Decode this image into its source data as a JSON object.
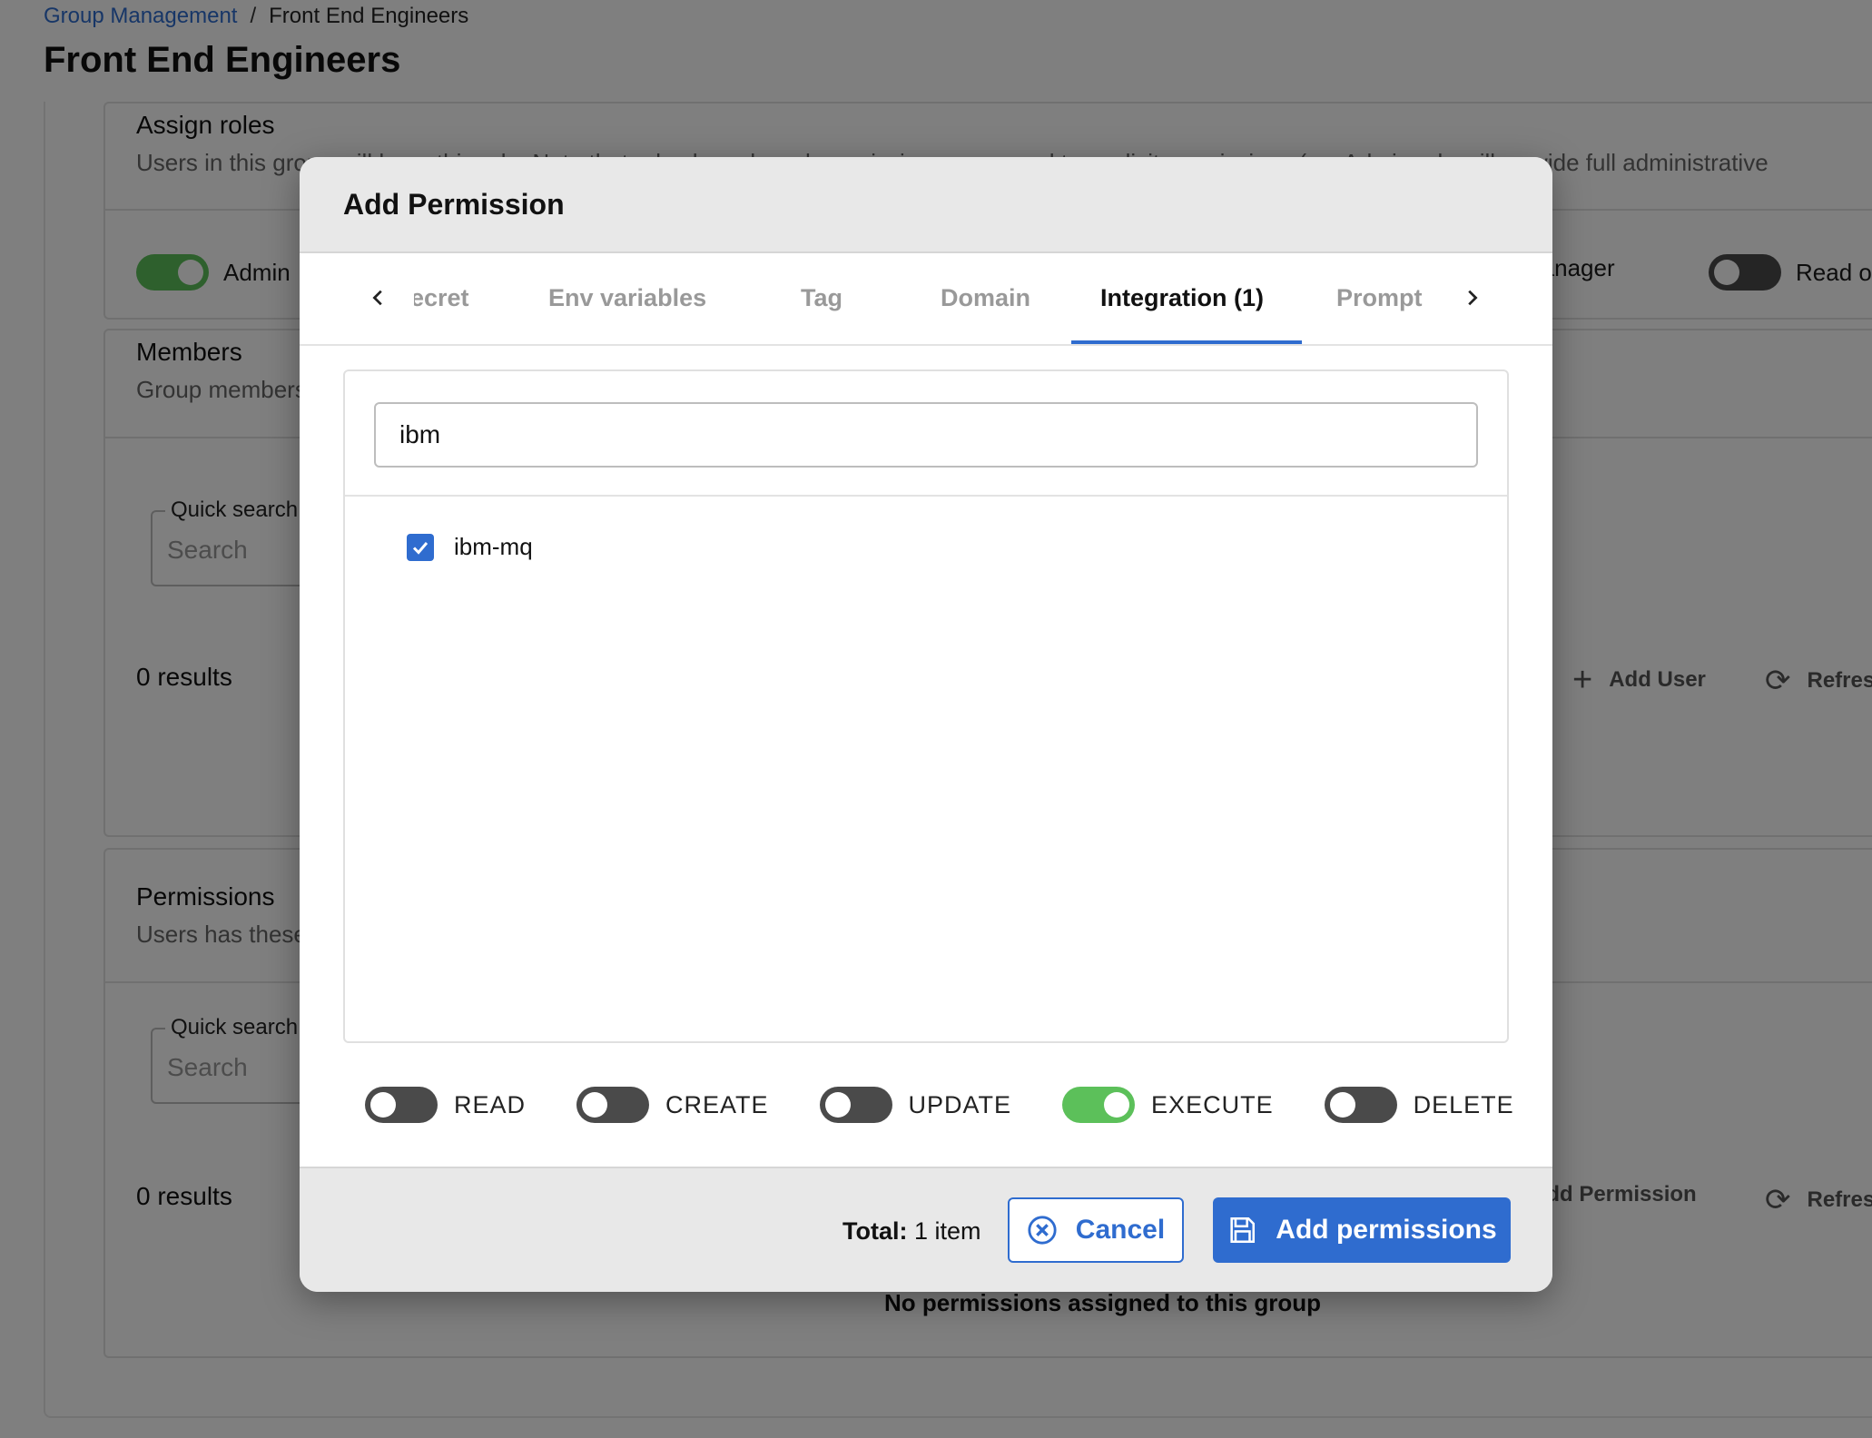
{
  "breadcrumb": {
    "parent": "Group Management",
    "separator": "/",
    "current": "Front End Engineers"
  },
  "page": {
    "title": "Front End Engineers"
  },
  "roles": {
    "title": "Assign roles",
    "description": "Users in this group will have this role. Note that roles have broad permissions compared to explicit permissions (ex. Admin role will provide full administrative",
    "items": [
      {
        "label": "Admin",
        "on": true
      },
      {
        "label": "Manager",
        "on": false
      },
      {
        "label": "Read only",
        "on": false
      }
    ]
  },
  "members": {
    "title": "Members",
    "description": "Group members",
    "quick_search_label": "Quick search",
    "search_placeholder": "Search",
    "results": "0 results",
    "add_label": "Add User",
    "refresh_label": "Refresh"
  },
  "permissions_section": {
    "title": "Permissions",
    "description": "Users has these permissions",
    "quick_search_label": "Quick search",
    "search_placeholder": "Search",
    "results": "0 results",
    "add_label": "Add Permission",
    "refresh_label": "Refresh",
    "empty": "No permissions assigned to this group"
  },
  "modal": {
    "title": "Add Permission",
    "tabs": [
      {
        "label": "ecret",
        "active": false
      },
      {
        "label": "Env variables",
        "active": false
      },
      {
        "label": "Tag",
        "active": false
      },
      {
        "label": "Domain",
        "active": false
      },
      {
        "label": "Integration (1)",
        "active": true
      },
      {
        "label": "Prompt",
        "active": false
      }
    ],
    "search_value": "ibm",
    "items": [
      {
        "label": "ibm-mq",
        "checked": true
      }
    ],
    "access": [
      {
        "label": "READ",
        "on": false
      },
      {
        "label": "CREATE",
        "on": false
      },
      {
        "label": "UPDATE",
        "on": false
      },
      {
        "label": "EXECUTE",
        "on": true
      },
      {
        "label": "DELETE",
        "on": false
      }
    ],
    "total_label": "Total:",
    "total_value": "1 item",
    "cancel_label": "Cancel",
    "submit_label": "Add permissions"
  },
  "colors": {
    "accent": "#2f6ccf",
    "toggle_on": "#5cc05a",
    "toggle_off": "#4a4a4a"
  }
}
